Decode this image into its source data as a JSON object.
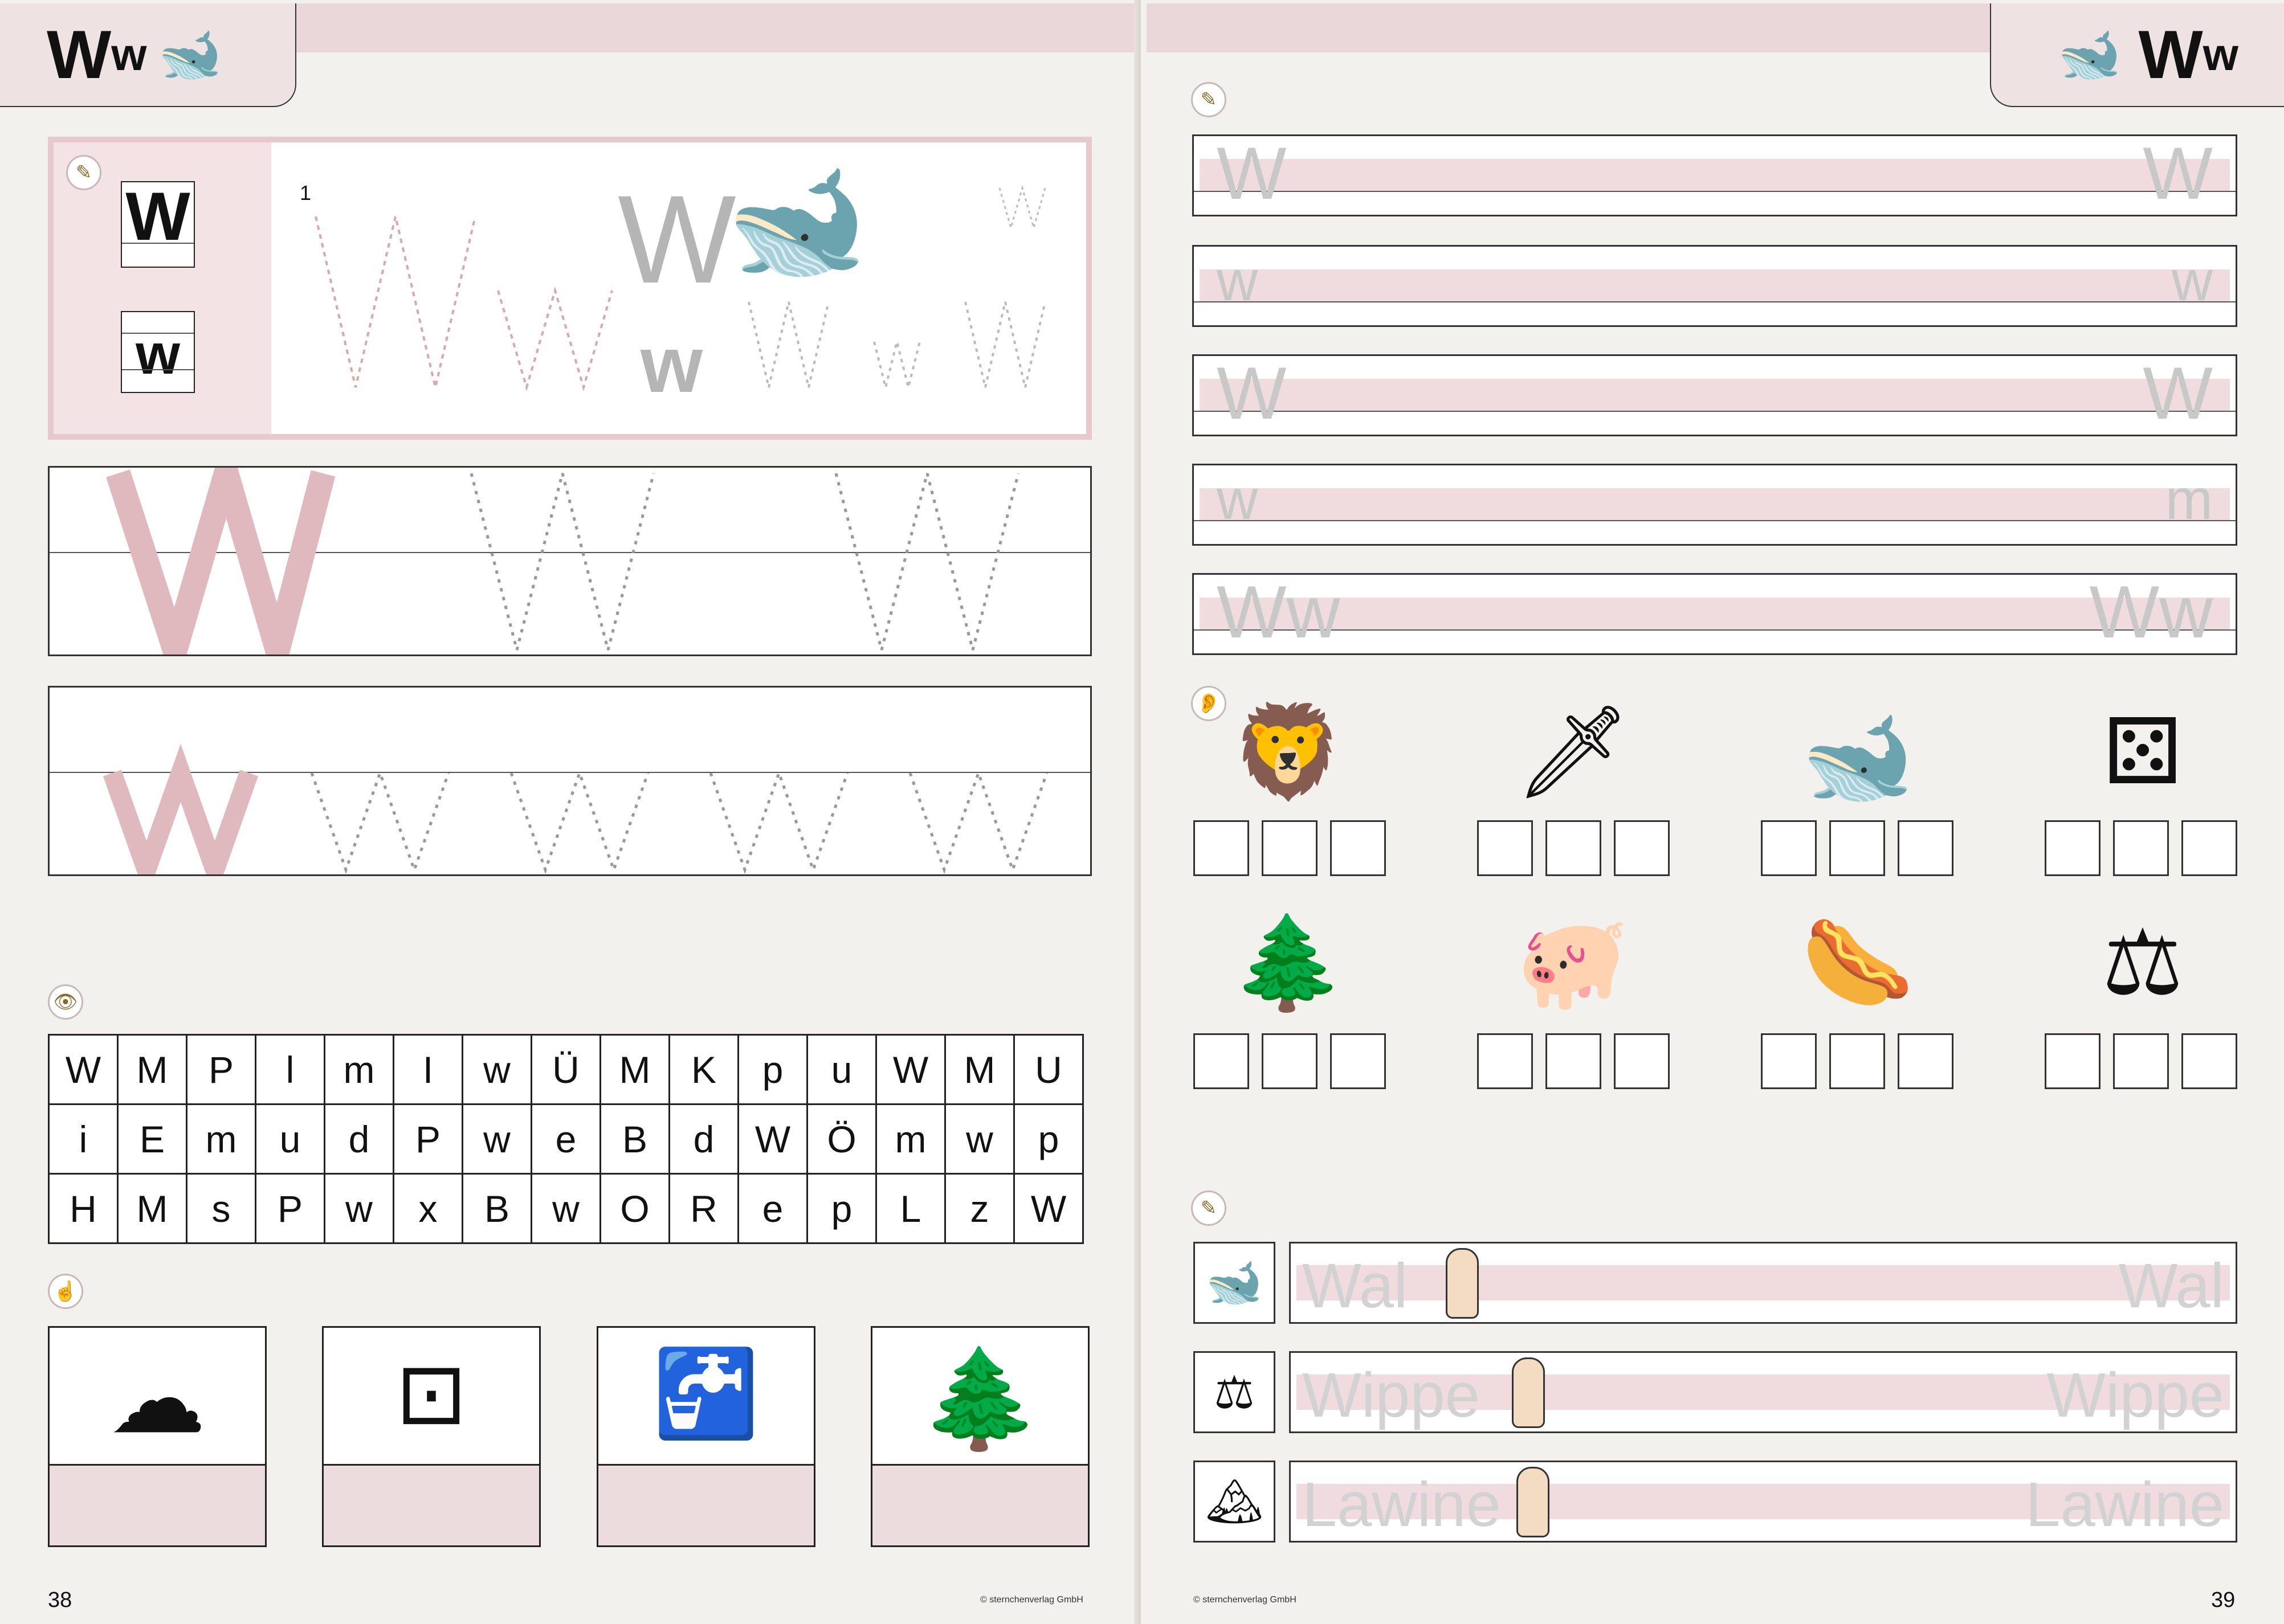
{
  "left_page": {
    "header_letter_upper": "W",
    "header_letter_lower": "w",
    "header_icon": "whale-icon",
    "page_number": "38",
    "copyright": "© sternchenverlag GmbH",
    "intro_box": {
      "upper": "W",
      "lower": "w",
      "gray_upper": "W",
      "gray_lower": "w",
      "picture": "whale-icon",
      "stroke_number": "1"
    },
    "letter_grid": {
      "rows": [
        [
          "W",
          "M",
          "P",
          "l",
          "m",
          "I",
          "w",
          "Ü",
          "M",
          "K",
          "p",
          "u",
          "W",
          "M",
          "U"
        ],
        [
          "i",
          "E",
          "m",
          "u",
          "d",
          "P",
          "w",
          "e",
          "B",
          "d",
          "W",
          "Ö",
          "m",
          "w",
          "p"
        ],
        [
          "H",
          "M",
          "s",
          "P",
          "w",
          "x",
          "B",
          "w",
          "O",
          "R",
          "e",
          "p",
          "L",
          "z",
          "W"
        ]
      ]
    },
    "picture_cards": [
      "cloud-icon",
      "washing-machine-icon",
      "faucet-icon",
      "forest-icon"
    ]
  },
  "right_page": {
    "header_letter_upper": "W",
    "header_letter_lower": "w",
    "header_icon": "whale-icon",
    "page_number": "39",
    "copyright": "© sternchenverlag GmbH",
    "writing_lines": [
      {
        "start": "W",
        "end": "W"
      },
      {
        "start": "w",
        "end": "w"
      },
      {
        "start": "W",
        "end": "W"
      },
      {
        "start": "w",
        "end": "m"
      },
      {
        "start": "Ww",
        "end": "Ww"
      }
    ],
    "sound_pictures_row1": [
      "lion-icon",
      "sword-icon",
      "whale-icon",
      "dice-icon"
    ],
    "sound_pictures_row2": [
      "forest-icon",
      "pig-icon",
      "sausage-icon",
      "scale-icon"
    ],
    "words": [
      {
        "icon": "whale-icon",
        "word": "Wal"
      },
      {
        "icon": "seesaw-icon",
        "word": "Wippe"
      },
      {
        "icon": "avalanche-icon",
        "word": "Lawine"
      }
    ]
  }
}
